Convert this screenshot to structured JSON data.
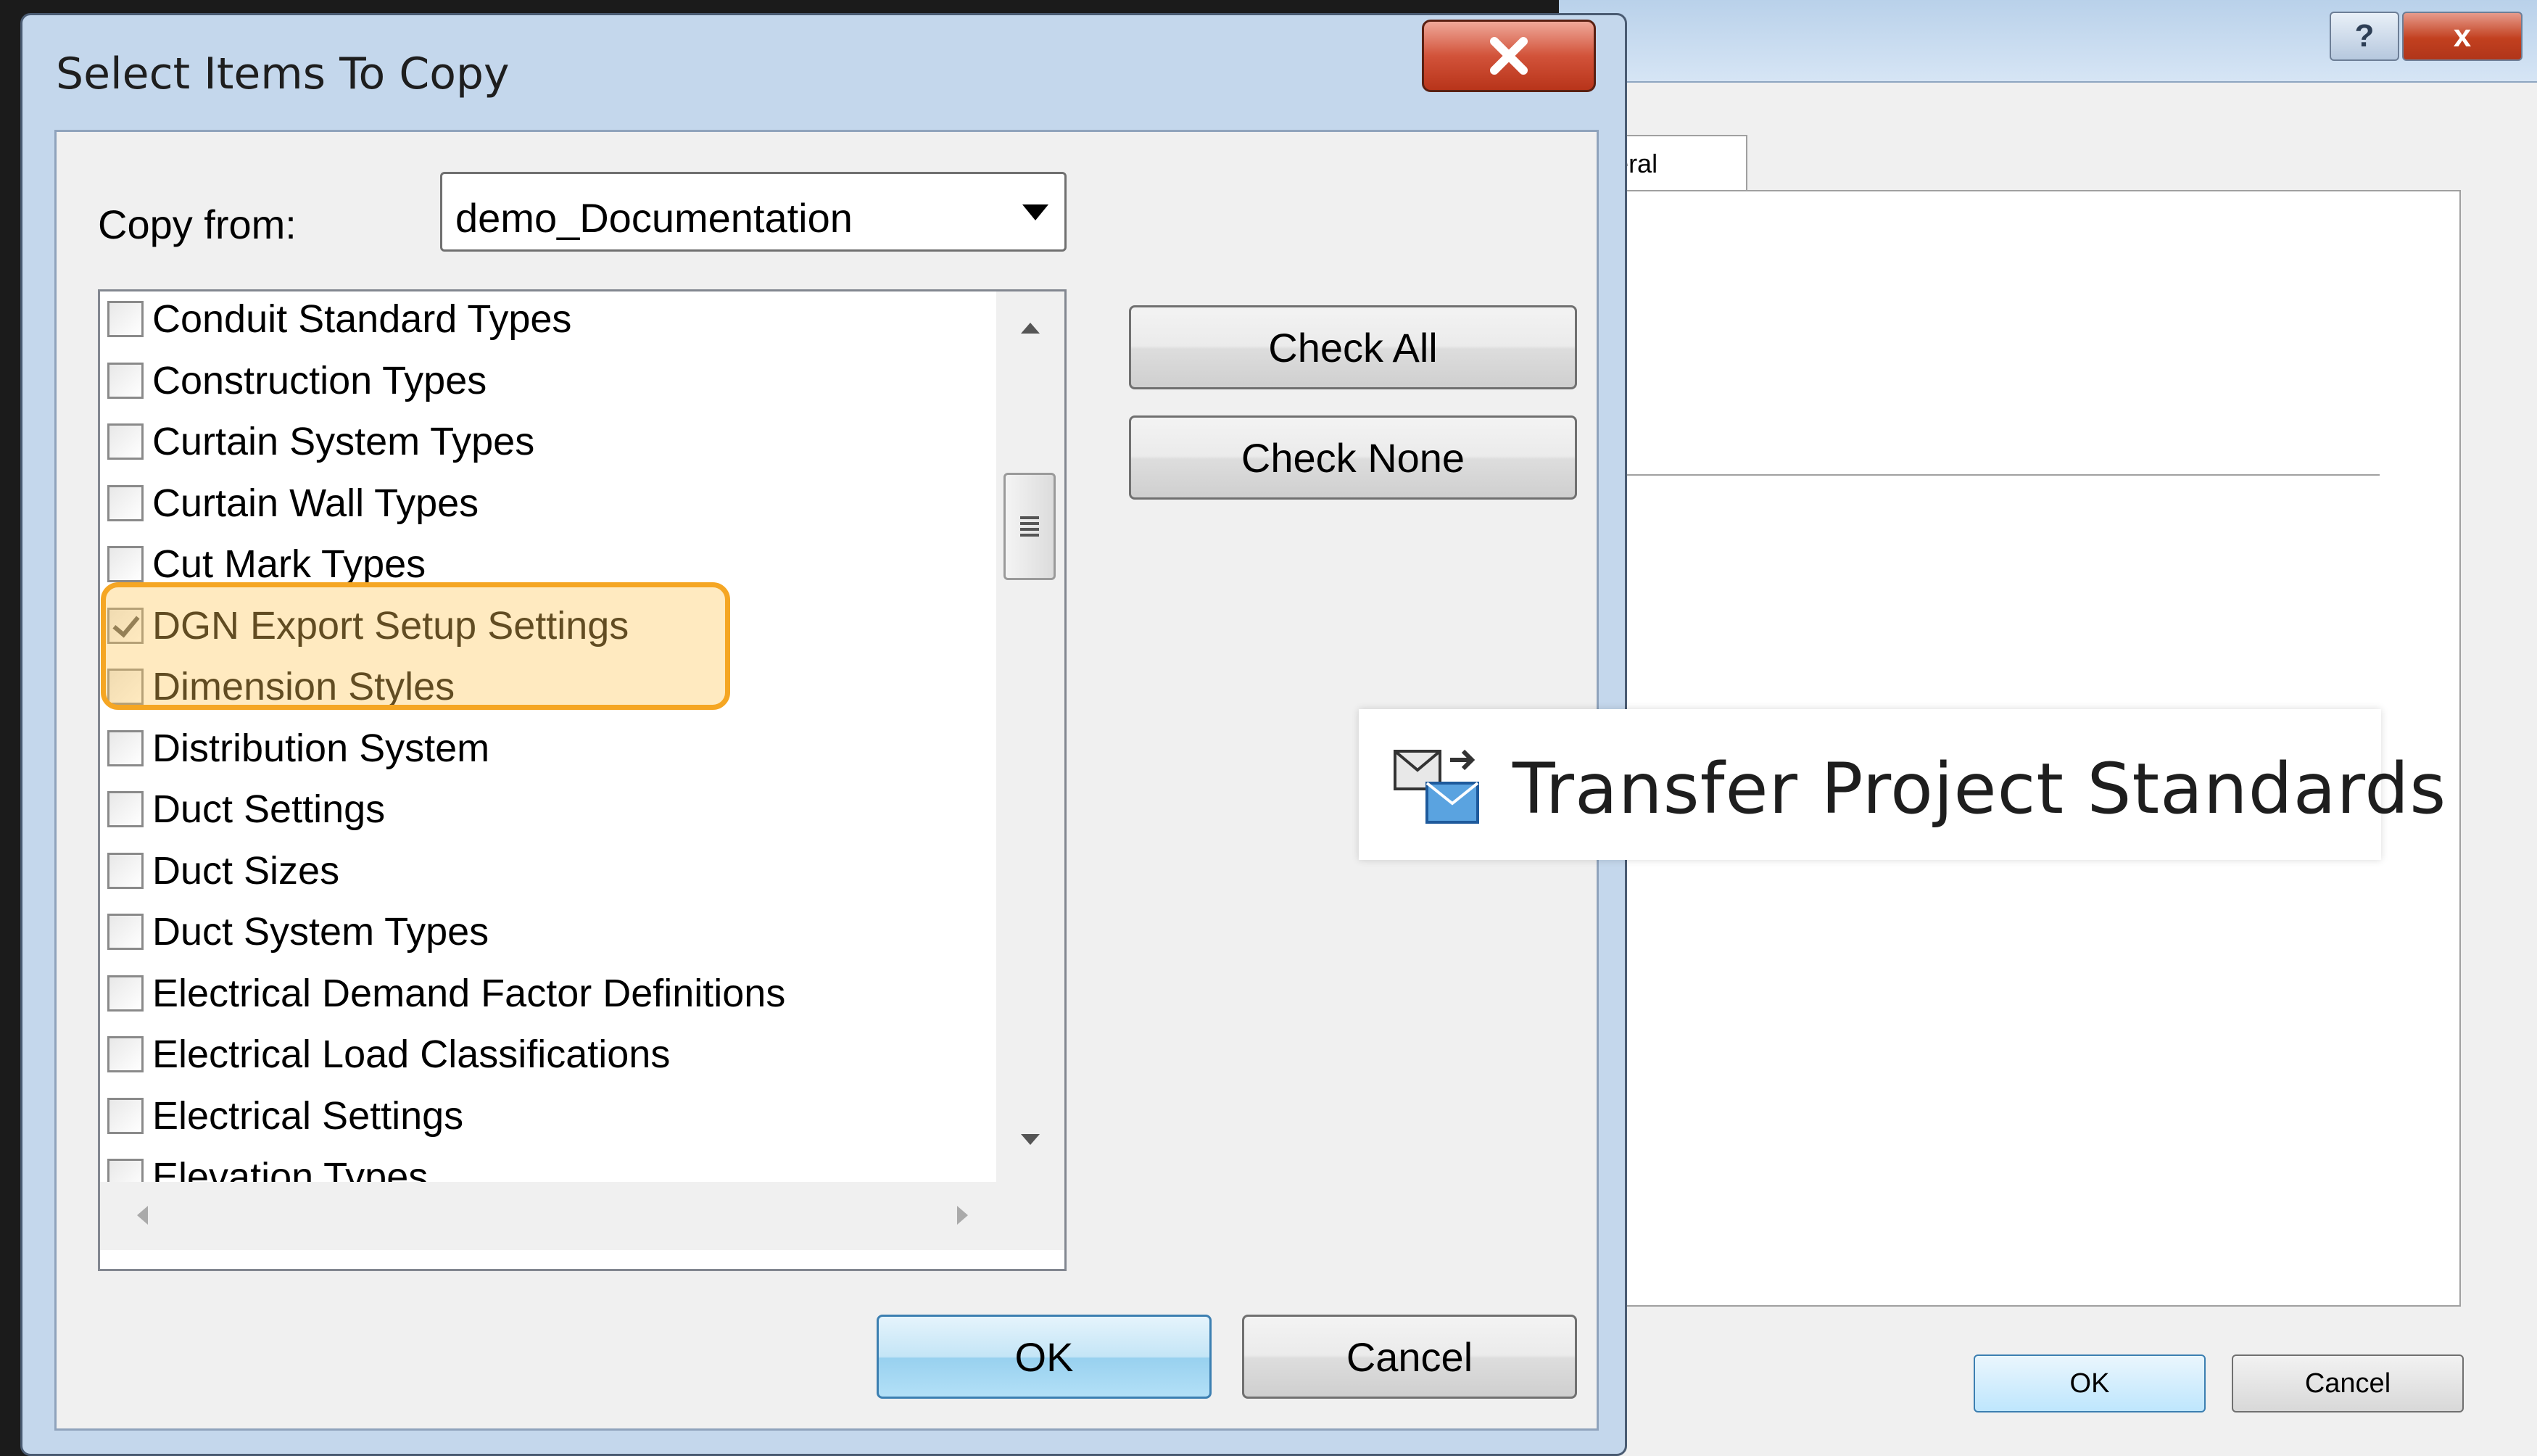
{
  "background_dialog": {
    "tab_label": "General",
    "ok_label": "OK",
    "cancel_label": "Cancel",
    "help_label": "?",
    "close_label": "x"
  },
  "dialog": {
    "title": "Select Items To Copy",
    "copy_from_label": "Copy from:",
    "copy_from_value": "demo_Documentation",
    "items": [
      {
        "label": "Conduit Standard Types",
        "checked": false
      },
      {
        "label": "Construction Types",
        "checked": false
      },
      {
        "label": "Curtain System Types",
        "checked": false
      },
      {
        "label": "Curtain Wall Types",
        "checked": false
      },
      {
        "label": "Cut Mark Types",
        "checked": false
      },
      {
        "label": "DGN Export Setup Settings",
        "checked": true
      },
      {
        "label": "Dimension Styles",
        "checked": false
      },
      {
        "label": "Distribution System",
        "checked": false
      },
      {
        "label": "Duct Settings",
        "checked": false
      },
      {
        "label": "Duct Sizes",
        "checked": false
      },
      {
        "label": "Duct System Types",
        "checked": false
      },
      {
        "label": "Electrical Demand Factor Definitions",
        "checked": false
      },
      {
        "label": "Electrical Load Classifications",
        "checked": false
      },
      {
        "label": "Electrical Settings",
        "checked": false
      },
      {
        "label": "Elevation Types",
        "checked": false
      }
    ],
    "check_all_label": "Check All",
    "check_none_label": "Check None",
    "ok_label": "OK",
    "cancel_label": "Cancel"
  },
  "callout": {
    "text": "Transfer  Project Standards",
    "icon": "transfer-standards-icon"
  },
  "colors": {
    "highlight": "#f5a623",
    "titlebar": "#c4d7ec",
    "close_button": "#c8432a"
  }
}
